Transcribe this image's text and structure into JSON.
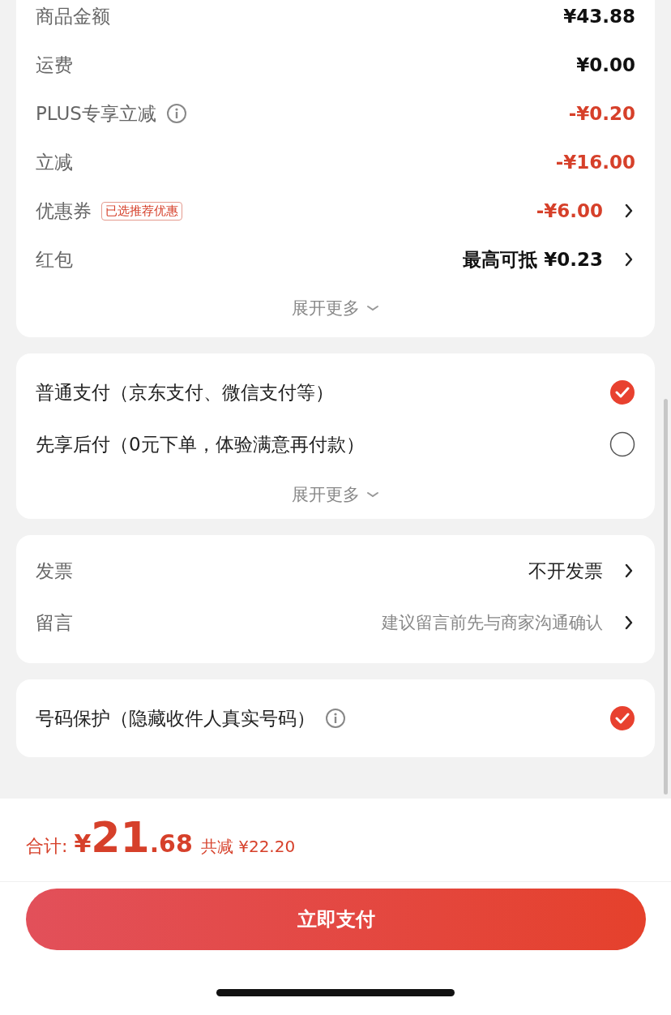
{
  "price_rows": [
    {
      "label": "商品金额",
      "value": "¥43.88",
      "kind": "price",
      "info": false,
      "chevron": false
    },
    {
      "label": "运费",
      "value": "¥0.00",
      "kind": "price",
      "info": false,
      "chevron": false
    },
    {
      "label": "PLUS专享立减",
      "value": "-¥0.20",
      "kind": "discount",
      "info": true,
      "chevron": false
    },
    {
      "label": "立减",
      "value": "-¥16.00",
      "kind": "discount",
      "info": false,
      "chevron": false
    },
    {
      "label": "优惠券",
      "badge": "已选推荐优惠",
      "value": "-¥6.00",
      "kind": "discount",
      "info": false,
      "chevron": true
    },
    {
      "label": "红包",
      "value": "最高可抵 ¥0.23",
      "kind": "price",
      "info": false,
      "chevron": true
    }
  ],
  "price_expand": "展开更多",
  "payment_options": [
    {
      "label": "普通支付（京东支付、微信支付等）",
      "selected": true
    },
    {
      "label": "先享后付（0元下单，体验满意再付款）",
      "selected": false
    }
  ],
  "payment_expand": "展开更多",
  "extra_rows": [
    {
      "label": "发票",
      "value": "不开发票",
      "kind": "value"
    },
    {
      "label": "留言",
      "value": "建议留言前先与商家沟通确认",
      "kind": "hint"
    }
  ],
  "phone_protection": {
    "label": "号码保护（隐藏收件人真实号码）",
    "info": true,
    "checked": true
  },
  "footer": {
    "total_label": "合计:",
    "currency": "¥",
    "total_integer": "21",
    "total_decimal": ".68",
    "savings": "共减 ¥22.20",
    "pay_button": "立即支付"
  }
}
